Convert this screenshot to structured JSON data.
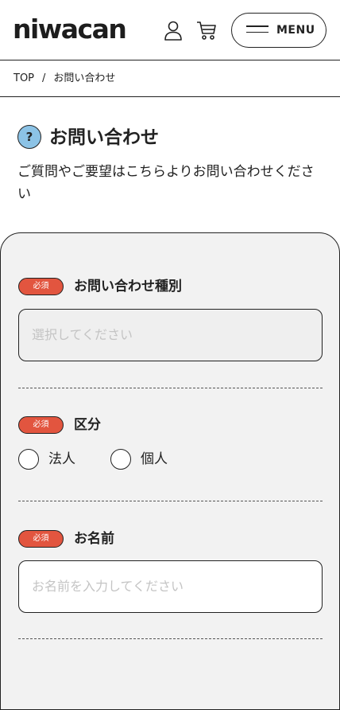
{
  "header": {
    "logo": "niwacan",
    "menu_label": "MENU"
  },
  "breadcrumb": {
    "home": "TOP",
    "separator": "/",
    "current": "お問い合わせ"
  },
  "page": {
    "title_icon": "?",
    "title": "お問い合わせ",
    "lead": "ご質問やご要望はこちらよりお問い合わせください"
  },
  "form": {
    "required_badge": "必須",
    "inquiry_type": {
      "label": "お問い合わせ種別",
      "placeholder": "選択してください"
    },
    "category": {
      "label": "区分",
      "options": [
        "法人",
        "個人"
      ]
    },
    "name": {
      "label": "お名前",
      "placeholder": "お名前を入力してください"
    }
  },
  "colors": {
    "accent_red": "#e2553f",
    "question_blue": "#8cc3e6",
    "panel_gray": "#f2f2f2"
  },
  "icons": [
    "user-icon",
    "cart-icon",
    "hamburger-icon",
    "question-icon"
  ]
}
